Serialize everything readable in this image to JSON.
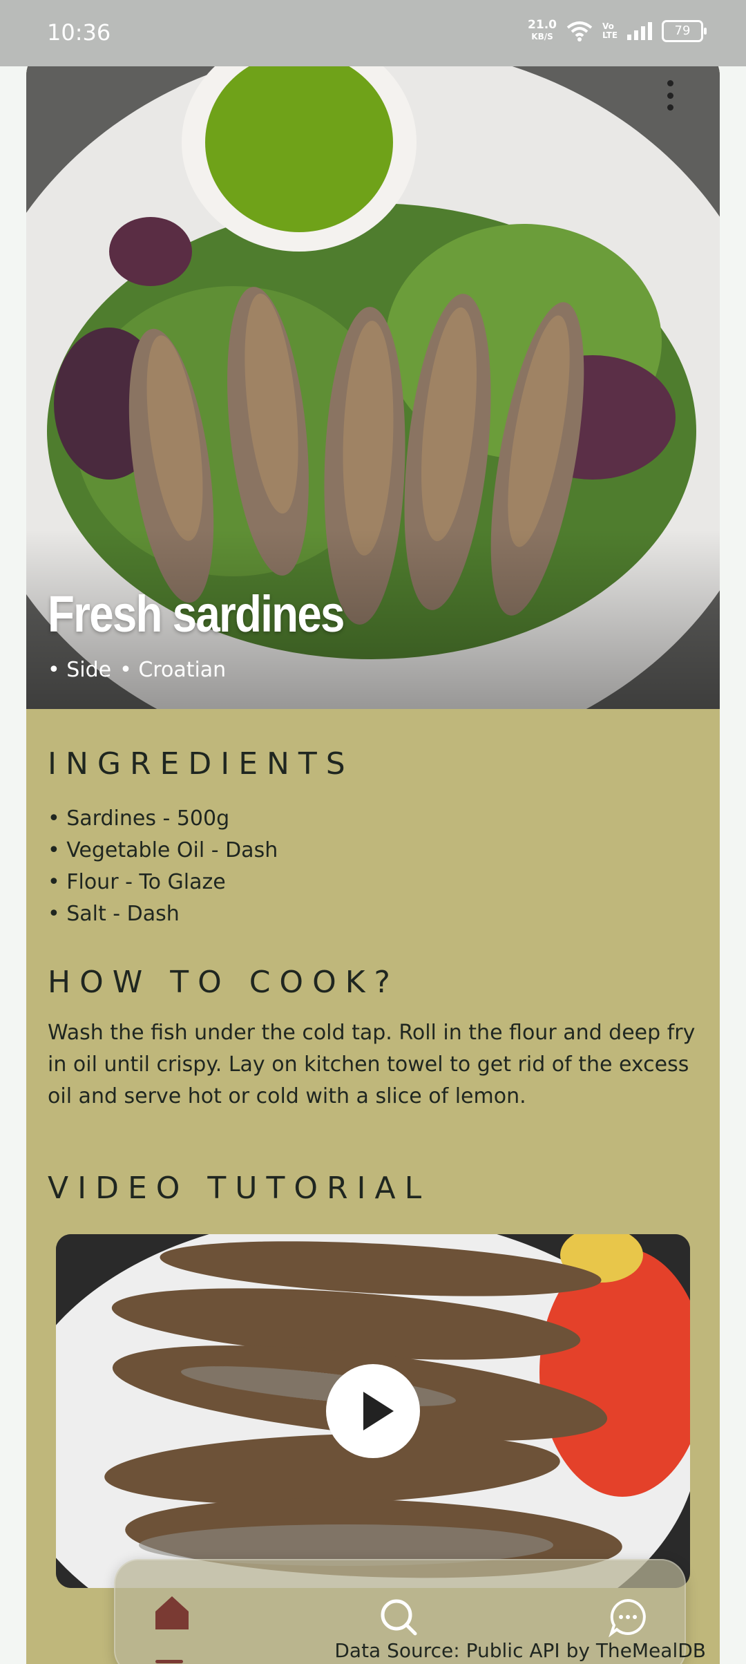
{
  "status_bar": {
    "time": "10:36",
    "net_speed": "21.0",
    "net_unit": "KB/S",
    "volte": "Vo LTE",
    "battery": "79"
  },
  "meal": {
    "title": "Fresh sardines",
    "tags": [
      "• Side",
      "• Croatian"
    ]
  },
  "sections": {
    "ingredients_title": "INGREDIENTS",
    "howto_title": "HOW TO COOK?",
    "video_title": "VIDEO TUTORIAL"
  },
  "ingredients": [
    "Sardines - 500g",
    "Vegetable Oil - Dash",
    "Flour - To Glaze",
    "Salt - Dash"
  ],
  "instructions": "Wash the fish under the cold tap. Roll in the flour and deep fry in oil until crispy. Lay on kitchen towel to get rid of the excess oil and serve hot or cold with a slice of lemon.",
  "nav": {
    "items": [
      {
        "icon": "home-icon",
        "active": true
      },
      {
        "icon": "search-icon",
        "active": false
      },
      {
        "icon": "chat-bubble-icon",
        "active": false
      }
    ]
  },
  "footer": {
    "source": "Data Source: Public API by TheMealDB"
  },
  "colors": {
    "content_background": "#bfb77b",
    "text": "#1f2620",
    "active_nav": "#7a3a33"
  }
}
